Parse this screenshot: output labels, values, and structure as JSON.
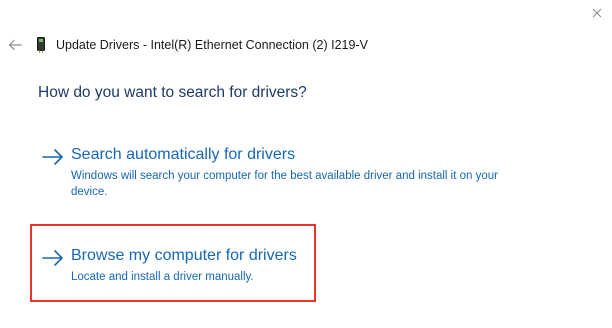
{
  "window": {
    "title": "Update Drivers - Intel(R) Ethernet Connection (2) I219-V"
  },
  "controls": {
    "close_icon": "close-icon",
    "back_icon": "back-arrow-icon",
    "device_icon": "network-adapter-icon"
  },
  "main": {
    "heading": "How do you want to search for drivers?",
    "options": [
      {
        "title": "Search automatically for drivers",
        "description": "Windows will search your computer for the best available driver and install it on your device.",
        "icon": "arrow-right-icon"
      },
      {
        "title": "Browse my computer for drivers",
        "description": "Locate and install a driver manually.",
        "icon": "arrow-right-icon",
        "highlighted": true
      }
    ]
  },
  "colors": {
    "link_blue": "#1767b5",
    "heading_blue": "#1f3a66",
    "highlight_red": "#e8342a"
  }
}
